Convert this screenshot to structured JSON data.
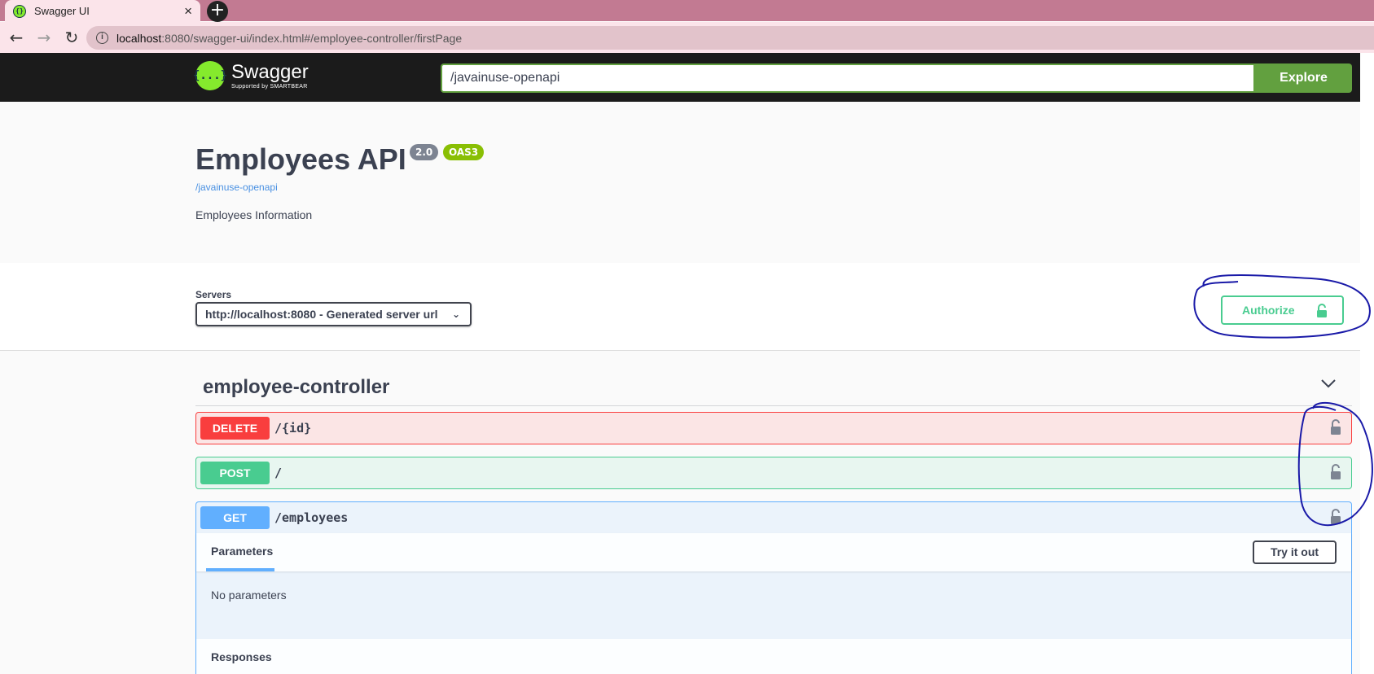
{
  "browser": {
    "tab_title": "Swagger UI",
    "tab_close": "×",
    "new_tab": "+",
    "url_host": "localhost",
    "url_rest": ":8080/swagger-ui/index.html#/employee-controller/firstPage",
    "back": "←",
    "forward": "→",
    "reload": "↻"
  },
  "topbar": {
    "logo_name": "Swagger",
    "logo_sub": "Supported by SMARTBEAR",
    "logo_glyph": "{...}",
    "spec_url": "/javainuse-openapi",
    "explore_label": "Explore"
  },
  "info": {
    "title": "Employees API",
    "version": "2.0",
    "oas": "OAS3",
    "link": "/javainuse-openapi",
    "description": "Employees Information"
  },
  "servers": {
    "label": "Servers",
    "selected": "http://localhost:8080 - Generated server url",
    "authorize_label": "Authorize"
  },
  "tag": {
    "name": "employee-controller"
  },
  "operations": [
    {
      "method": "DELETE",
      "path": "/{id}"
    },
    {
      "method": "POST",
      "path": "/"
    },
    {
      "method": "GET",
      "path": "/employees"
    }
  ],
  "get_body": {
    "params_tab": "Parameters",
    "try_label": "Try it out",
    "no_params": "No parameters",
    "responses_title": "Responses"
  },
  "colors": {
    "swagger_green": "#85ea2d",
    "explore_green": "#62a03f",
    "authorize_green": "#49cc90",
    "delete_red": "#f93e3e",
    "post_green": "#49cc90",
    "get_blue": "#61affe",
    "annotation_ink": "#1a1aa8"
  }
}
